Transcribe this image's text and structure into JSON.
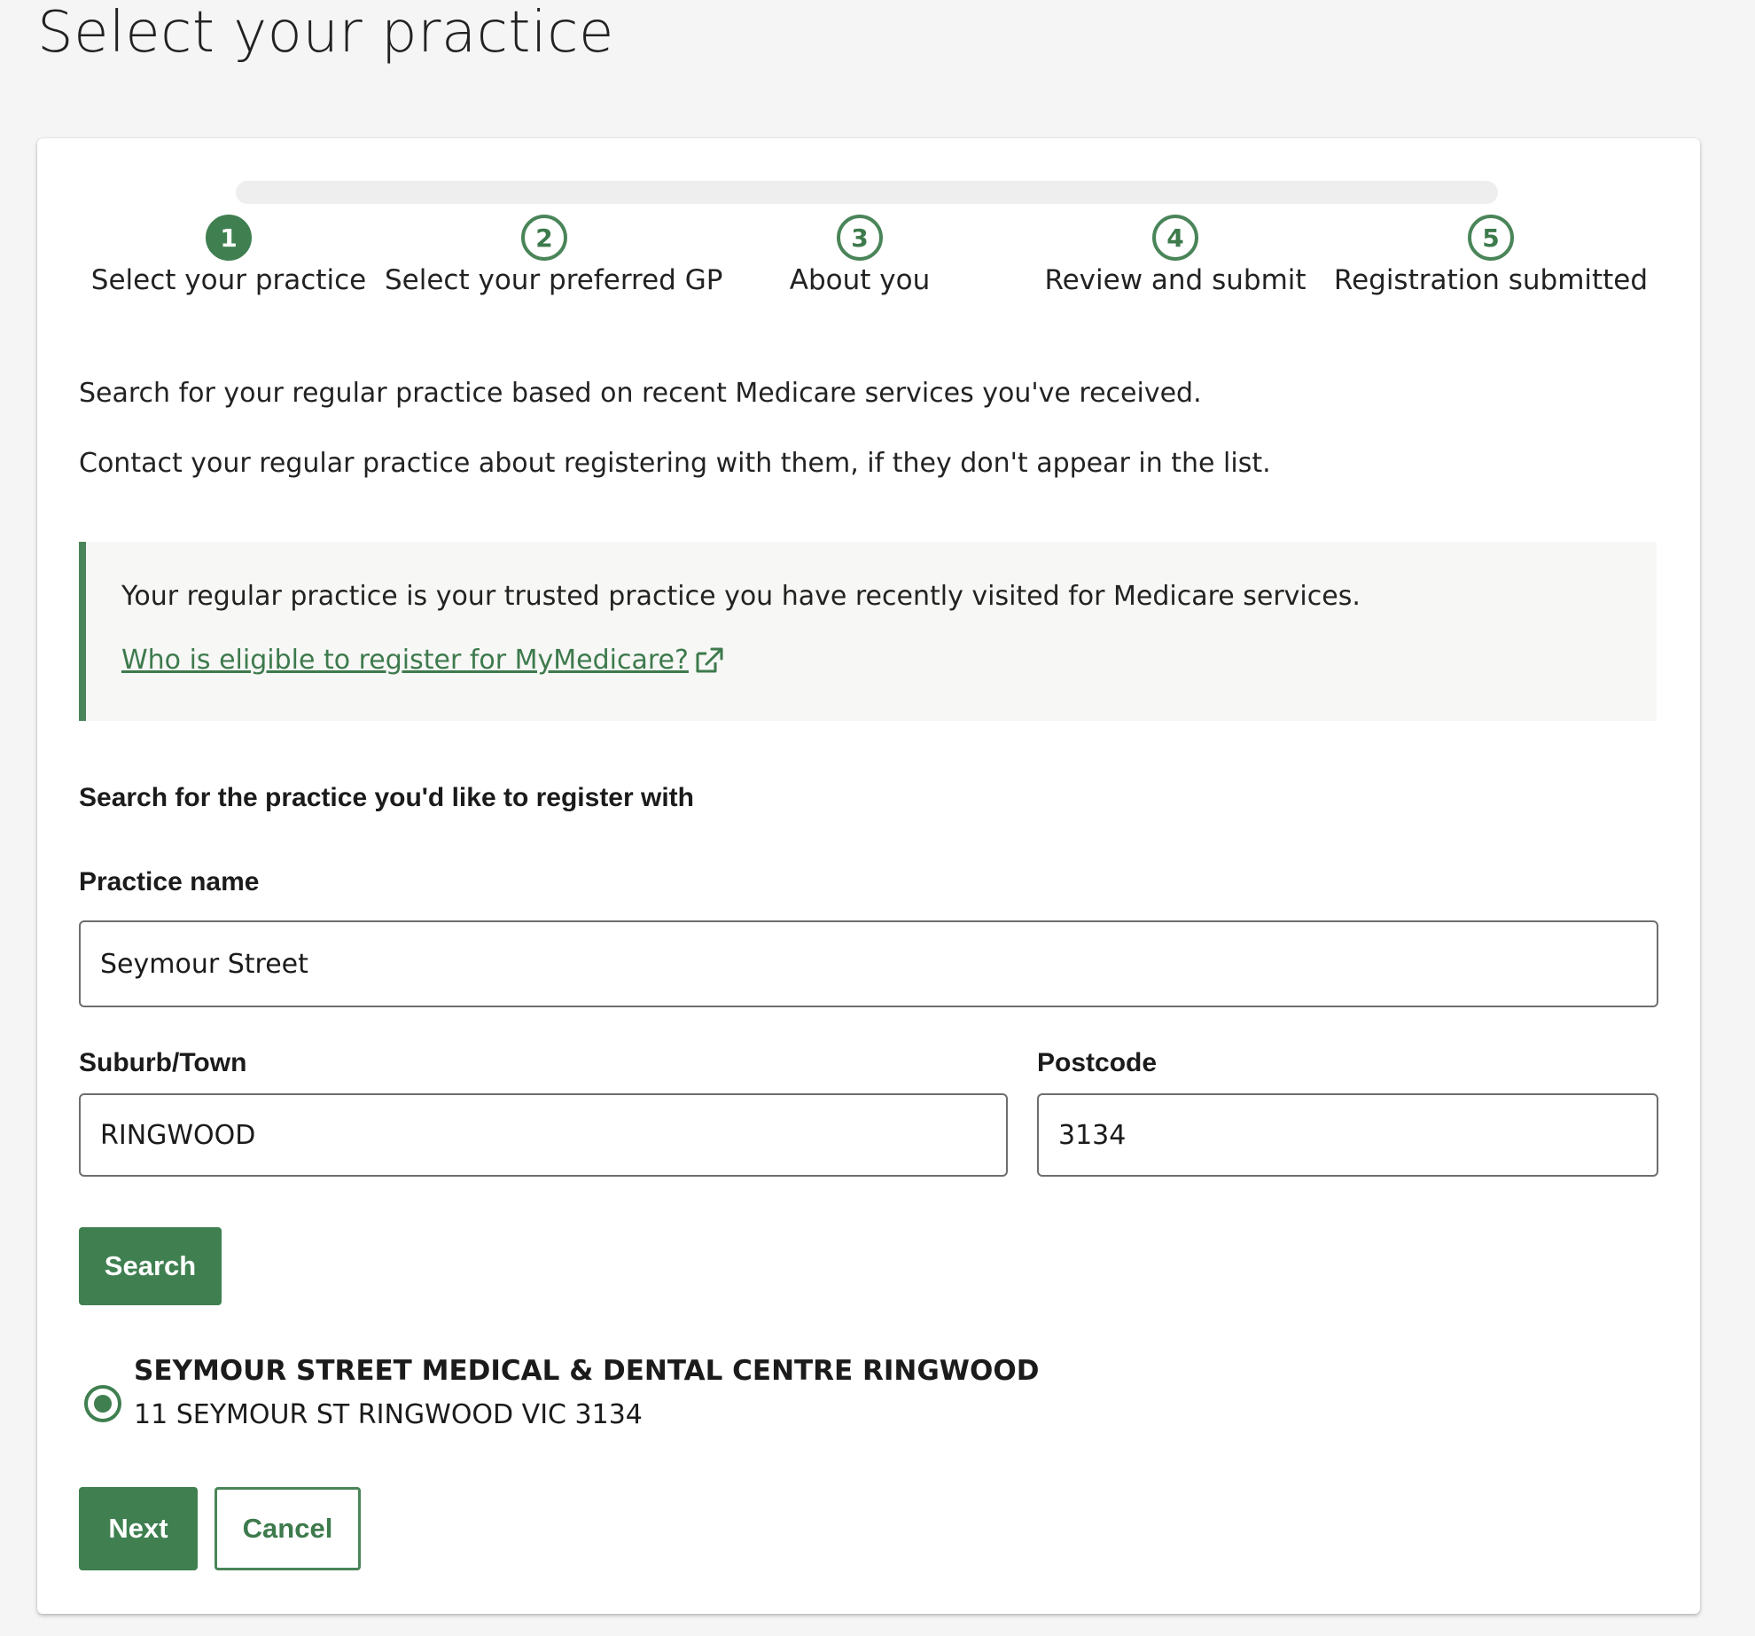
{
  "page": {
    "title": "Select your practice"
  },
  "stepper": {
    "steps": [
      {
        "number": "1",
        "label": "Select your practice",
        "active": true
      },
      {
        "number": "2",
        "label": "Select your preferred GP",
        "active": false
      },
      {
        "number": "3",
        "label": "About you",
        "active": false
      },
      {
        "number": "4",
        "label": "Review and submit",
        "active": false
      },
      {
        "number": "5",
        "label": "Registration submitted",
        "active": false
      }
    ]
  },
  "intro": {
    "line1": "Search for your regular practice based on recent Medicare services you've received.",
    "line2": "Contact your regular practice about registering with them, if they don't appear in the list."
  },
  "callout": {
    "text": "Your regular practice is your trusted practice you have recently visited for Medicare services.",
    "link_label": "Who is eligible to register for MyMedicare?"
  },
  "search_form": {
    "heading": "Search for the practice you'd like to register with",
    "practice_name": {
      "label": "Practice name",
      "value": "Seymour Street"
    },
    "suburb": {
      "label": "Suburb/Town",
      "value": "RINGWOOD"
    },
    "postcode": {
      "label": "Postcode",
      "value": "3134"
    },
    "search_label": "Search"
  },
  "results": [
    {
      "name": "SEYMOUR STREET MEDICAL & DENTAL CENTRE RINGWOOD",
      "address": "11 SEYMOUR ST RINGWOOD VIC 3134",
      "selected": true
    }
  ],
  "actions": {
    "next_label": "Next",
    "cancel_label": "Cancel"
  },
  "colors": {
    "accent": "#3f7f50",
    "track": "#eeeeee",
    "callout_bg": "#f7f7f6"
  },
  "icons": {
    "external_link": "external-link-icon"
  }
}
